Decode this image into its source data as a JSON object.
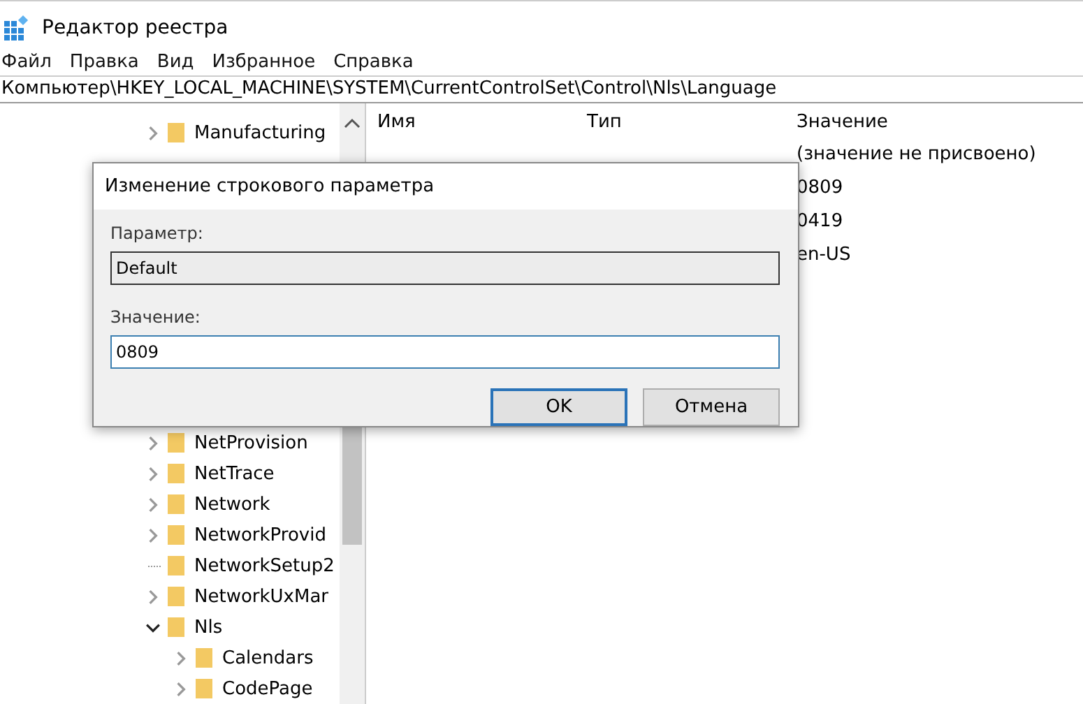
{
  "window": {
    "title": "Редактор реестра"
  },
  "menu": [
    "Файл",
    "Правка",
    "Вид",
    "Избранное",
    "Справка"
  ],
  "address": "Компьютер\\HKEY_LOCAL_MACHINE\\SYSTEM\\CurrentControlSet\\Control\\Nls\\Language",
  "tree": {
    "top_items": [
      {
        "label": "Manufacturing",
        "kind": "branch",
        "expanded": false
      }
    ],
    "bottom_items": [
      {
        "label": "NetProvision",
        "kind": "branch",
        "expanded": false
      },
      {
        "label": "NetTrace",
        "kind": "branch",
        "expanded": false
      },
      {
        "label": "Network",
        "kind": "branch",
        "expanded": false
      },
      {
        "label": "NetworkProvid",
        "kind": "branch",
        "expanded": false
      },
      {
        "label": "NetworkSetup2",
        "kind": "leaf"
      },
      {
        "label": "NetworkUxMar",
        "kind": "branch",
        "expanded": false
      },
      {
        "label": "Nls",
        "kind": "branch",
        "expanded": true,
        "children": [
          {
            "label": "Calendars",
            "kind": "branch",
            "expanded": false
          },
          {
            "label": "CodePage",
            "kind": "branch",
            "expanded": false
          }
        ]
      }
    ]
  },
  "values": {
    "columns": [
      "Имя",
      "Тип",
      "Значение"
    ],
    "rows": [
      {
        "value": "(значение не присвоено)"
      },
      {
        "value": "0809"
      },
      {
        "value": "0419"
      },
      {
        "value": "en-US"
      }
    ]
  },
  "dialog": {
    "title": "Изменение строкового параметра",
    "name_label": "Параметр:",
    "name_value": "Default",
    "value_label": "Значение:",
    "value": "0809",
    "buttons": [
      {
        "label": "OK",
        "selected": true
      },
      {
        "label": "Отмена",
        "selected": false
      }
    ]
  }
}
